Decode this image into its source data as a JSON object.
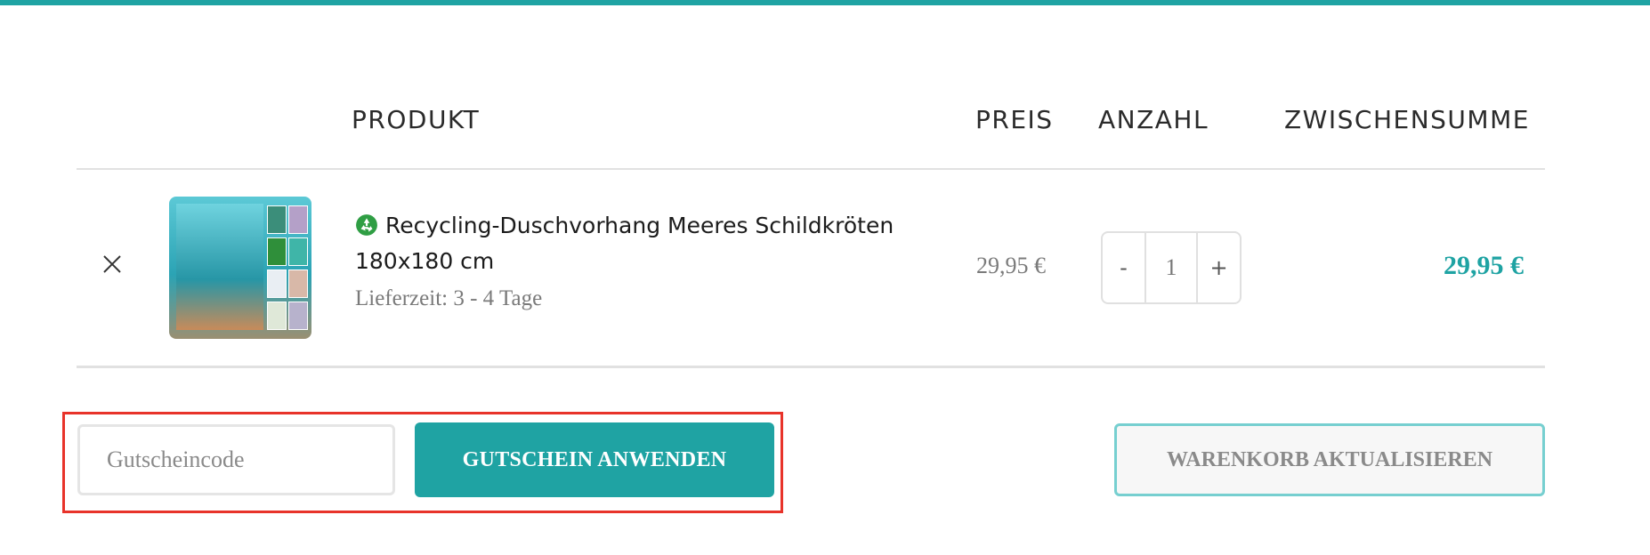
{
  "colors": {
    "accent": "#1fa3a3",
    "highlight_border": "#e8332a"
  },
  "table": {
    "headers": [
      "PRODUKT",
      "PREIS",
      "ANZAHL",
      "ZWISCHENSUMME"
    ]
  },
  "item": {
    "name": "Recycling-Duschvorhang Meeres Schildkröten 180x180 cm",
    "name_icon": "recycle-icon",
    "delivery": "Lieferzeit: 3 - 4 Tage",
    "price": "29,95 €",
    "quantity": "1",
    "decrement_label": "-",
    "increment_label": "+",
    "subtotal": "29,95 €",
    "remove_icon": "close-icon"
  },
  "coupon": {
    "placeholder": "Gutscheincode",
    "apply_label": "GUTSCHEIN ANWENDEN"
  },
  "update_cart_label": "WARENKORB AKTUALISIEREN"
}
